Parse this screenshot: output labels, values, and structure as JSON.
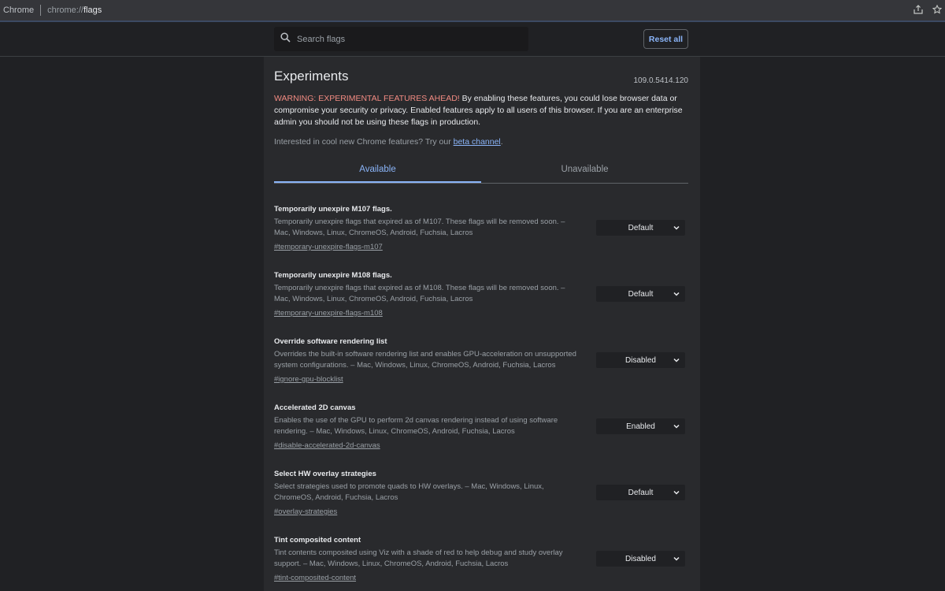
{
  "addressbar": {
    "site": "Chrome",
    "url_prefix": "chrome://",
    "url_main": "flags"
  },
  "header": {
    "search_placeholder": "Search flags",
    "reset_label": "Reset all"
  },
  "main": {
    "title": "Experiments",
    "version": "109.0.5414.120",
    "warning_red": "WARNING: EXPERIMENTAL FEATURES AHEAD!",
    "warning_text": " By enabling these features, you could lose browser data or compromise your security or privacy. Enabled features apply to all users of this browser. If you are an enterprise admin you should not be using these flags in production.",
    "interest_text": "Interested in cool new Chrome features? Try our ",
    "interest_link": "beta channel",
    "interest_end": ".",
    "tabs": [
      {
        "label": "Available",
        "active": true
      },
      {
        "label": "Unavailable",
        "active": false
      }
    ]
  },
  "flags": [
    {
      "name": "Temporarily unexpire M107 flags.",
      "desc": "Temporarily unexpire flags that expired as of M107. These flags will be removed soon. – Mac, Windows, Linux, ChromeOS, Android, Fuchsia, Lacros",
      "link": "#temporary-unexpire-flags-m107",
      "value": "Default"
    },
    {
      "name": "Temporarily unexpire M108 flags.",
      "desc": "Temporarily unexpire flags that expired as of M108. These flags will be removed soon. – Mac, Windows, Linux, ChromeOS, Android, Fuchsia, Lacros",
      "link": "#temporary-unexpire-flags-m108",
      "value": "Default"
    },
    {
      "name": "Override software rendering list",
      "desc": "Overrides the built-in software rendering list and enables GPU-acceleration on unsupported system configurations. – Mac, Windows, Linux, ChromeOS, Android, Fuchsia, Lacros",
      "link": "#ignore-gpu-blocklist",
      "value": "Disabled"
    },
    {
      "name": "Accelerated 2D canvas",
      "desc": "Enables the use of the GPU to perform 2d canvas rendering instead of using software rendering. – Mac, Windows, Linux, ChromeOS, Android, Fuchsia, Lacros",
      "link": "#disable-accelerated-2d-canvas",
      "value": "Enabled"
    },
    {
      "name": "Select HW overlay strategies",
      "desc": "Select strategies used to promote quads to HW overlays. – Mac, Windows, Linux, ChromeOS, Android, Fuchsia, Lacros",
      "link": "#overlay-strategies",
      "value": "Default"
    },
    {
      "name": "Tint composited content",
      "desc": "Tint contents composited using Viz with a shade of red to help debug and study overlay support. – Mac, Windows, Linux, ChromeOS, Android, Fuchsia, Lacros",
      "link": "#tint-composited-content",
      "value": "Disabled"
    }
  ]
}
